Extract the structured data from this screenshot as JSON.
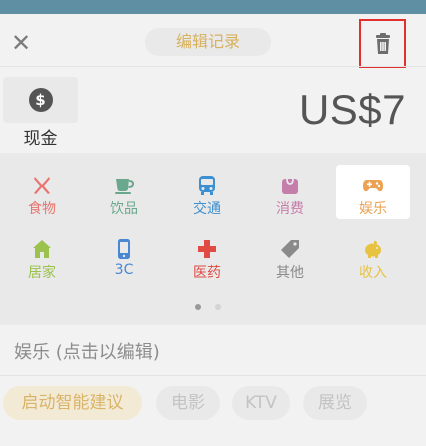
{
  "header": {
    "close_glyph": "✕",
    "title": "编辑记录"
  },
  "account": {
    "icon_glyph": "$",
    "label": "现金"
  },
  "amount": "US$7",
  "categories_page1": [
    {
      "key": "food",
      "label": "食物",
      "icon": "fork-knife-icon",
      "color": "#e8746d"
    },
    {
      "key": "drinks",
      "label": "饮品",
      "icon": "cup-icon",
      "color": "#6aa88d"
    },
    {
      "key": "transport",
      "label": "交通",
      "icon": "bus-icon",
      "color": "#3c8fd0"
    },
    {
      "key": "shopping",
      "label": "消费",
      "icon": "shopping-bag-icon",
      "color": "#c57daa"
    },
    {
      "key": "entertainment",
      "label": "娱乐",
      "icon": "gamepad-icon",
      "color": "#eba252",
      "selected": true
    },
    {
      "key": "home",
      "label": "居家",
      "icon": "house-icon",
      "color": "#9ac24c"
    },
    {
      "key": "3c",
      "label": "3C",
      "icon": "phone-icon",
      "color": "#4a87d3"
    },
    {
      "key": "medical",
      "label": "医药",
      "icon": "red-cross-icon",
      "color": "#e04b43"
    },
    {
      "key": "other",
      "label": "其他",
      "icon": "tag-icon",
      "color": "#8a8a8a"
    },
    {
      "key": "income",
      "label": "收入",
      "icon": "piggy-bank-icon",
      "color": "#e8c341"
    }
  ],
  "pager": {
    "current": 1,
    "total": 2
  },
  "note_placeholder": "娱乐 (点击以编辑)",
  "suggestions": {
    "primary_label": "启动智能建议",
    "chips": [
      "电影",
      "KTV",
      "展览"
    ]
  },
  "colors": {
    "accent": "#d7b15e",
    "header_strip": "#5f8fa2",
    "highlight_box": "#e0312f"
  }
}
